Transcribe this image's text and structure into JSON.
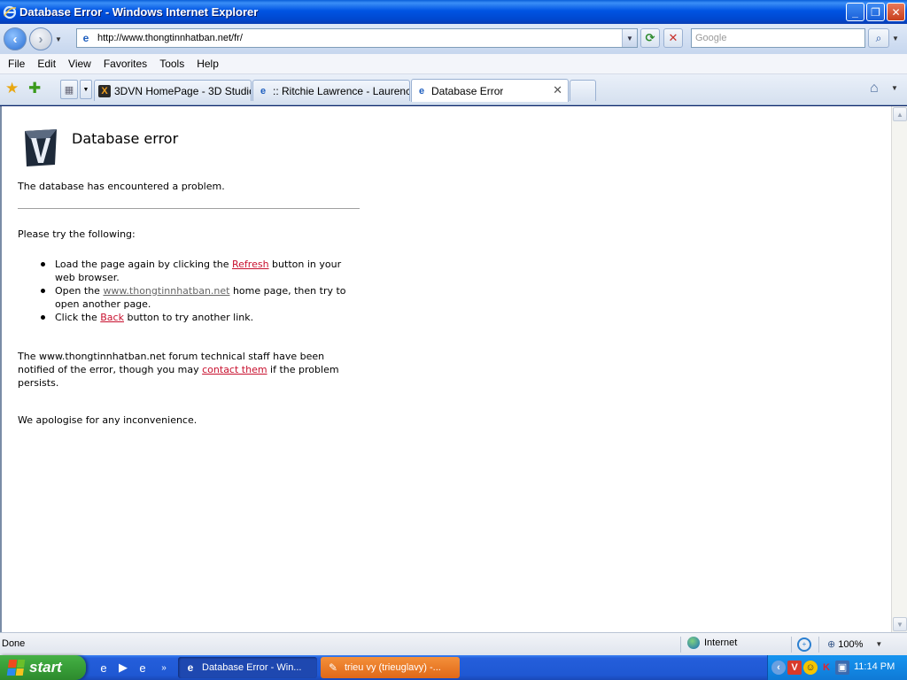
{
  "window": {
    "title": "Database Error - Windows Internet Explorer",
    "controls": {
      "minimize": "_",
      "maximize": "❐",
      "close": "✕"
    }
  },
  "address": {
    "url": "http://www.thongtinnhatban.net/fr/",
    "search_placeholder": "Google"
  },
  "menu": [
    "File",
    "Edit",
    "View",
    "Favorites",
    "Tools",
    "Help"
  ],
  "tabs": [
    {
      "label": "3DVN HomePage - 3D Studio ...",
      "icon": "3dvn-icon",
      "active": false
    },
    {
      "label": ":: Ritchie Lawrence - Laurenc...",
      "icon": "ie-page-icon",
      "active": false
    },
    {
      "label": "Database Error",
      "icon": "ie-page-icon",
      "active": true
    }
  ],
  "page": {
    "heading": "Database error",
    "problem": "The database has encountered a problem.",
    "try_intro": "Please try the following:",
    "items": [
      {
        "before": "Load the page again by clicking the ",
        "link": "Refresh",
        "after": " button in your web browser."
      },
      {
        "before": "Open the ",
        "link": "www.thongtinnhatban.net",
        "after": " home page, then try to open another page."
      },
      {
        "before": "Click the ",
        "link": "Back",
        "after": " button to try another link."
      }
    ],
    "staff_before": "The www.thongtinnhatban.net forum technical staff have been notified of the error, though you may ",
    "staff_link": "contact them",
    "staff_after": " if the problem persists.",
    "apology": "We apologise for any inconvenience."
  },
  "status": {
    "text": "Done",
    "zone": "Internet",
    "zoom": "100%"
  },
  "taskbar": {
    "start": "start",
    "tasks": [
      {
        "label": "Database Error - Win...",
        "active": true
      },
      {
        "label": "trieu vy (trieuglavy) -...",
        "active": false
      }
    ],
    "clock": "11:14 PM"
  },
  "colors": {
    "link_red": "#c8102e",
    "title_blue": "#0054e3",
    "start_green": "#389e38"
  }
}
